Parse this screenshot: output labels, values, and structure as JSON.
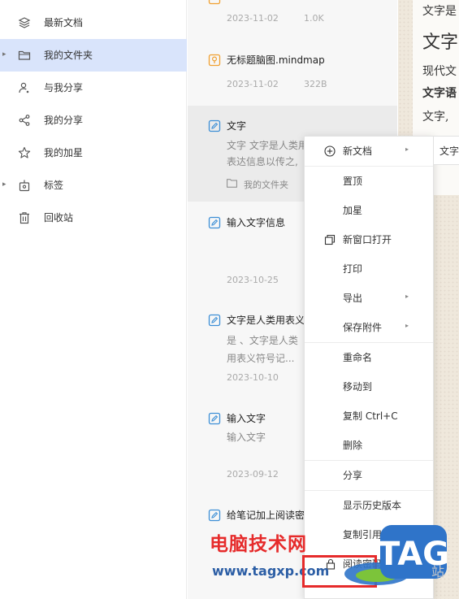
{
  "sidebar": {
    "items": [
      {
        "label": "最新文档",
        "icon": "layers-icon"
      },
      {
        "label": "我的文件夹",
        "icon": "folder-icon",
        "active": true,
        "expandable": true
      },
      {
        "label": "与我分享",
        "icon": "shared-with-me-icon"
      },
      {
        "label": "我的分享",
        "icon": "share-icon"
      },
      {
        "label": "我的加星",
        "icon": "star-icon"
      },
      {
        "label": "标签",
        "icon": "tag-icon",
        "expandable": true
      },
      {
        "label": "回收站",
        "icon": "trash-icon"
      }
    ]
  },
  "notes": [
    {
      "title": "",
      "date": "2023-11-02",
      "size": "1.0K",
      "icon": "mindmap-icon"
    },
    {
      "title": "无标题脑图.mindmap",
      "date": "2023-11-02",
      "size": "322B",
      "icon": "mindmap-icon"
    },
    {
      "title": "文字",
      "excerpt1": "文字 文字是人类用",
      "excerpt2": "表达信息以传之,",
      "folder": "我的文件夹",
      "icon": "note-icon",
      "selected": true
    },
    {
      "title": "输入文字信息",
      "date": "2023-10-25",
      "icon": "note-icon"
    },
    {
      "title": "文字是人类用表义",
      "excerpt1": "是 、文字是人类",
      "excerpt2": "用表义符号记...",
      "date": "2023-10-10",
      "icon": "note-icon"
    },
    {
      "title": "输入文字",
      "excerpt1": "输入文字",
      "date": "2023-09-12",
      "icon": "note-icon"
    },
    {
      "title": "给笔记加上阅读密",
      "icon": "note-icon"
    }
  ],
  "editor": {
    "lines": [
      "文字是",
      "文字",
      "现代文",
      "文字语",
      "文字,"
    ]
  },
  "context_menu": {
    "items": [
      {
        "label": "新文档",
        "icon": "plus-circle-icon",
        "submenu": true
      },
      {
        "label": "置顶"
      },
      {
        "label": "加星"
      },
      {
        "label": "新窗口打开",
        "icon": "new-window-icon"
      },
      {
        "label": "打印"
      },
      {
        "label": "导出",
        "submenu": true
      },
      {
        "label": "保存附件",
        "submenu": true
      },
      {
        "label": "重命名"
      },
      {
        "label": "移动到"
      },
      {
        "label": "复制 Ctrl+C"
      },
      {
        "label": "删除"
      },
      {
        "label": "分享"
      },
      {
        "label": "显示历史版本"
      },
      {
        "label": "复制引用链接"
      },
      {
        "label": "阅读密码"
      }
    ],
    "submenu_peek": "文字"
  },
  "watermark": {
    "site_name": "电脑技术网",
    "url": "www.tagxp.com",
    "tag": "TAG",
    "zhan": "站"
  },
  "colors": {
    "sidebar_active": "#d9e4fb",
    "accent_orange": "#f0a030",
    "accent_blue": "#3d8fd6",
    "watermark_red": "#e62b2b",
    "watermark_blue": "#2c5ea5"
  }
}
